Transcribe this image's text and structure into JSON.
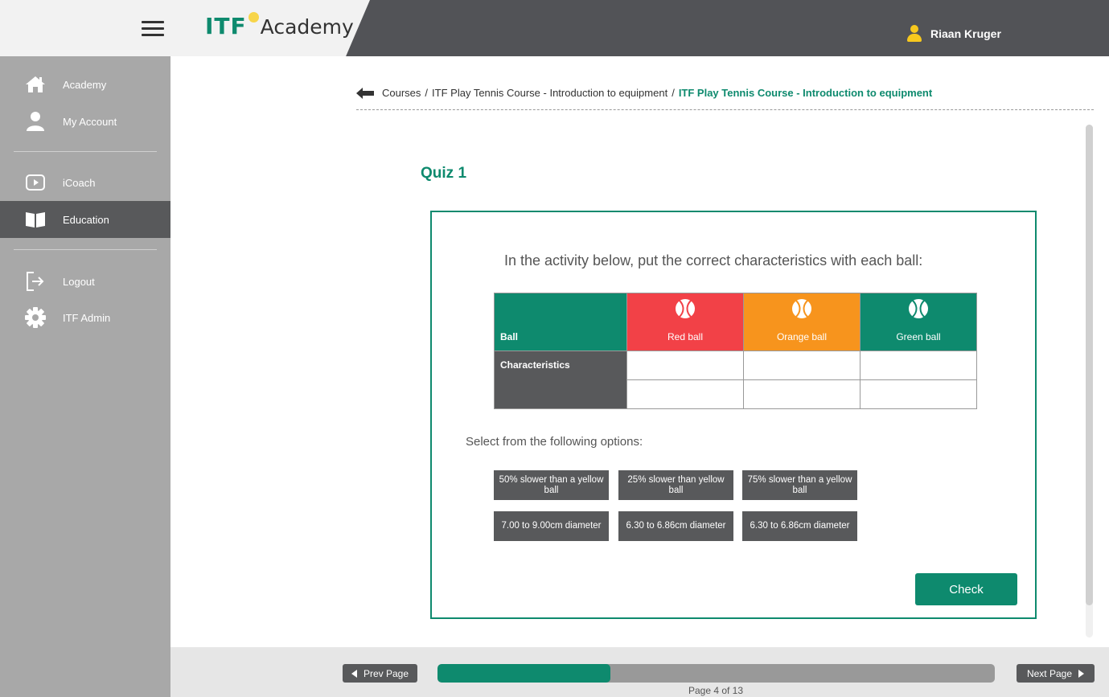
{
  "header": {
    "logo_itf": "ITF",
    "logo_academy": "Academy",
    "user_name": "Riaan Kruger",
    "accent_color": "#0e8a6e"
  },
  "sidebar": {
    "items": [
      {
        "label": "Academy",
        "icon": "home-icon"
      },
      {
        "label": "My Account",
        "icon": "user-icon"
      },
      {
        "label": "iCoach",
        "icon": "play-icon"
      },
      {
        "label": "Education",
        "icon": "book-icon",
        "active": true
      },
      {
        "label": "Logout",
        "icon": "logout-icon"
      },
      {
        "label": "ITF Admin",
        "icon": "gear-icon"
      }
    ]
  },
  "breadcrumb": {
    "items": [
      "Courses",
      "ITF Play Tennis Course - Introduction to equipment"
    ],
    "current": "ITF Play Tennis Course - Introduction to equipment"
  },
  "quiz": {
    "title": "Quiz 1",
    "instruction": "In the activity below, put the correct characteristics with each ball:",
    "table": {
      "row_header": "Ball",
      "row_label": "Characteristics",
      "columns": [
        {
          "label": "Red ball",
          "color": "#f24147"
        },
        {
          "label": "Orange ball",
          "color": "#f7941d"
        },
        {
          "label": "Green ball",
          "color": "#0e8a6e"
        }
      ]
    },
    "select_text": "Select from the following options:",
    "options": [
      "50% slower than a yellow ball",
      "25% slower than yellow ball",
      "75% slower than a yellow ball",
      "7.00 to 9.00cm diameter",
      "6.30 to 6.86cm diameter",
      "6.30 to 6.86cm diameter"
    ],
    "check_label": "Check"
  },
  "footer": {
    "prev_label": "Prev Page",
    "next_label": "Next Page",
    "page_label": "Page 4 of 13",
    "progress_fraction": 0.31
  }
}
